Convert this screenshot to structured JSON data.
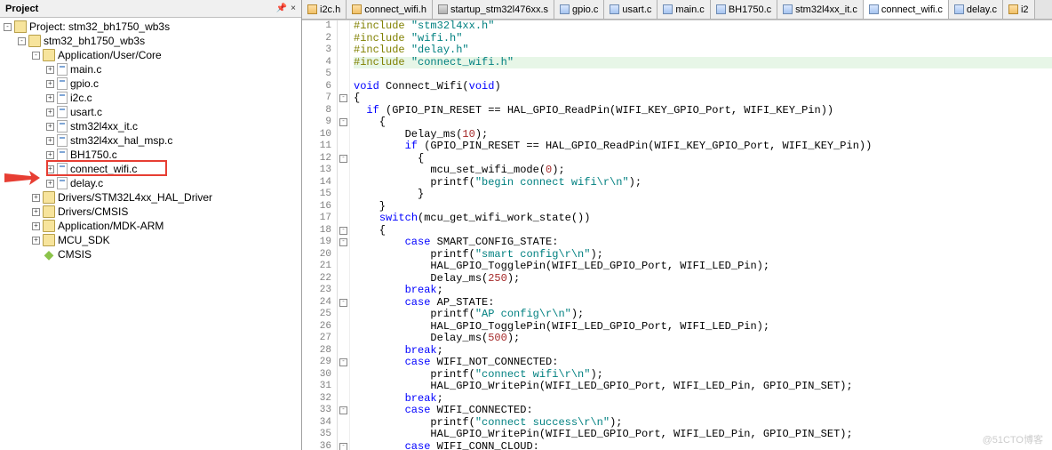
{
  "panel": {
    "title": "Project",
    "pin": "📌",
    "close": "×"
  },
  "tree": [
    {
      "d": 0,
      "exp": "-",
      "ico": "workspace",
      "label": "Project: stm32_bh1750_wb3s"
    },
    {
      "d": 1,
      "exp": "-",
      "ico": "folder-y",
      "label": "stm32_bh1750_wb3s"
    },
    {
      "d": 2,
      "exp": "-",
      "ico": "folder-y",
      "label": "Application/User/Core"
    },
    {
      "d": 3,
      "exp": "+",
      "ico": "cfile",
      "label": "main.c"
    },
    {
      "d": 3,
      "exp": "+",
      "ico": "cfile",
      "label": "gpio.c"
    },
    {
      "d": 3,
      "exp": "+",
      "ico": "cfile",
      "label": "i2c.c"
    },
    {
      "d": 3,
      "exp": "+",
      "ico": "cfile",
      "label": "usart.c"
    },
    {
      "d": 3,
      "exp": "+",
      "ico": "cfile",
      "label": "stm32l4xx_it.c"
    },
    {
      "d": 3,
      "exp": "+",
      "ico": "cfile",
      "label": "stm32l4xx_hal_msp.c"
    },
    {
      "d": 3,
      "exp": "+",
      "ico": "cfile",
      "label": "BH1750.c"
    },
    {
      "d": 3,
      "exp": "+",
      "ico": "cfile",
      "label": "connect_wifi.c",
      "hl": true
    },
    {
      "d": 3,
      "exp": "+",
      "ico": "cfile",
      "label": "delay.c"
    },
    {
      "d": 2,
      "exp": "+",
      "ico": "folder-y",
      "label": "Drivers/STM32L4xx_HAL_Driver"
    },
    {
      "d": 2,
      "exp": "+",
      "ico": "folder-y",
      "label": "Drivers/CMSIS"
    },
    {
      "d": 2,
      "exp": "+",
      "ico": "folder-y",
      "label": "Application/MDK-ARM"
    },
    {
      "d": 2,
      "exp": "+",
      "ico": "folder-y",
      "label": "MCU_SDK"
    },
    {
      "d": 2,
      "exp": " ",
      "ico": "cmsis",
      "label": "CMSIS",
      "cmsis": true
    }
  ],
  "tabs": [
    {
      "label": "i2c.h",
      "ico": "hfile"
    },
    {
      "label": "connect_wifi.h",
      "ico": "hfile"
    },
    {
      "label": "startup_stm32l476xx.s",
      "ico": "sfile"
    },
    {
      "label": "gpio.c",
      "ico": "cfile"
    },
    {
      "label": "usart.c",
      "ico": "cfile"
    },
    {
      "label": "main.c",
      "ico": "cfile"
    },
    {
      "label": "BH1750.c",
      "ico": "cfile"
    },
    {
      "label": "stm32l4xx_it.c",
      "ico": "cfile"
    },
    {
      "label": "connect_wifi.c",
      "ico": "cfile",
      "active": true
    },
    {
      "label": "delay.c",
      "ico": "cfile"
    },
    {
      "label": "i2",
      "ico": "hfile"
    }
  ],
  "code": [
    {
      "n": 1,
      "f": "",
      "t": [
        [
          "k-pre",
          "#include "
        ],
        [
          "k-str",
          "\"stm32l4xx.h\""
        ]
      ]
    },
    {
      "n": 2,
      "f": "",
      "t": [
        [
          "k-pre",
          "#include "
        ],
        [
          "k-str",
          "\"wifi.h\""
        ]
      ]
    },
    {
      "n": 3,
      "f": "",
      "t": [
        [
          "k-pre",
          "#include "
        ],
        [
          "k-str",
          "\"delay.h\""
        ]
      ]
    },
    {
      "n": 4,
      "f": "",
      "hl": true,
      "t": [
        [
          "k-pre",
          "#include "
        ],
        [
          "k-str",
          "\"connect_wifi.h\""
        ]
      ]
    },
    {
      "n": 5,
      "f": "",
      "t": []
    },
    {
      "n": 6,
      "f": "",
      "t": [
        [
          "k-type",
          "void"
        ],
        [
          "k-norm",
          " Connect_Wifi("
        ],
        [
          "k-type",
          "void"
        ],
        [
          "k-norm",
          ")"
        ]
      ]
    },
    {
      "n": 7,
      "f": "-",
      "t": [
        [
          "k-norm",
          "{"
        ]
      ]
    },
    {
      "n": 8,
      "f": "",
      "t": [
        [
          "k-norm",
          "  "
        ],
        [
          "k-kw",
          "if"
        ],
        [
          "k-norm",
          " (GPIO_PIN_RESET == HAL_GPIO_ReadPin(WIFI_KEY_GPIO_Port, WIFI_KEY_Pin))"
        ]
      ]
    },
    {
      "n": 9,
      "f": "-",
      "t": [
        [
          "k-norm",
          "    {"
        ]
      ]
    },
    {
      "n": 10,
      "f": "",
      "t": [
        [
          "k-norm",
          "        Delay_ms("
        ],
        [
          "k-num",
          "10"
        ],
        [
          "k-norm",
          ");"
        ]
      ]
    },
    {
      "n": 11,
      "f": "",
      "t": [
        [
          "k-norm",
          "        "
        ],
        [
          "k-kw",
          "if"
        ],
        [
          "k-norm",
          " (GPIO_PIN_RESET == HAL_GPIO_ReadPin(WIFI_KEY_GPIO_Port, WIFI_KEY_Pin))"
        ]
      ]
    },
    {
      "n": 12,
      "f": "-",
      "t": [
        [
          "k-norm",
          "          {"
        ]
      ]
    },
    {
      "n": 13,
      "f": "",
      "t": [
        [
          "k-norm",
          "            mcu_set_wifi_mode("
        ],
        [
          "k-num",
          "0"
        ],
        [
          "k-norm",
          ");"
        ]
      ]
    },
    {
      "n": 14,
      "f": "",
      "t": [
        [
          "k-norm",
          "            printf("
        ],
        [
          "k-str",
          "\"begin connect wifi\\r\\n\""
        ],
        [
          "k-norm",
          ");"
        ]
      ]
    },
    {
      "n": 15,
      "f": "",
      "t": [
        [
          "k-norm",
          "          }"
        ]
      ]
    },
    {
      "n": 16,
      "f": "",
      "t": [
        [
          "k-norm",
          "    }"
        ]
      ]
    },
    {
      "n": 17,
      "f": "",
      "t": [
        [
          "k-norm",
          "    "
        ],
        [
          "k-kw",
          "switch"
        ],
        [
          "k-norm",
          "(mcu_get_wifi_work_state())"
        ]
      ]
    },
    {
      "n": 18,
      "f": "-",
      "t": [
        [
          "k-norm",
          "    {"
        ]
      ]
    },
    {
      "n": 19,
      "f": "-",
      "t": [
        [
          "k-norm",
          "        "
        ],
        [
          "k-kw",
          "case"
        ],
        [
          "k-norm",
          " SMART_CONFIG_STATE:"
        ]
      ]
    },
    {
      "n": 20,
      "f": "",
      "t": [
        [
          "k-norm",
          "            printf("
        ],
        [
          "k-str",
          "\"smart config\\r\\n\""
        ],
        [
          "k-norm",
          ");"
        ]
      ]
    },
    {
      "n": 21,
      "f": "",
      "t": [
        [
          "k-norm",
          "            HAL_GPIO_TogglePin(WIFI_LED_GPIO_Port, WIFI_LED_Pin);"
        ]
      ]
    },
    {
      "n": 22,
      "f": "",
      "t": [
        [
          "k-norm",
          "            Delay_ms("
        ],
        [
          "k-num",
          "250"
        ],
        [
          "k-norm",
          ");"
        ]
      ]
    },
    {
      "n": 23,
      "f": "",
      "t": [
        [
          "k-norm",
          "        "
        ],
        [
          "k-kw",
          "break"
        ],
        [
          "k-norm",
          ";"
        ]
      ]
    },
    {
      "n": 24,
      "f": "-",
      "t": [
        [
          "k-norm",
          "        "
        ],
        [
          "k-kw",
          "case"
        ],
        [
          "k-norm",
          " AP_STATE:"
        ]
      ]
    },
    {
      "n": 25,
      "f": "",
      "t": [
        [
          "k-norm",
          "            printf("
        ],
        [
          "k-str",
          "\"AP config\\r\\n\""
        ],
        [
          "k-norm",
          ");"
        ]
      ]
    },
    {
      "n": 26,
      "f": "",
      "t": [
        [
          "k-norm",
          "            HAL_GPIO_TogglePin(WIFI_LED_GPIO_Port, WIFI_LED_Pin);"
        ]
      ]
    },
    {
      "n": 27,
      "f": "",
      "t": [
        [
          "k-norm",
          "            Delay_ms("
        ],
        [
          "k-num",
          "500"
        ],
        [
          "k-norm",
          ");"
        ]
      ]
    },
    {
      "n": 28,
      "f": "",
      "t": [
        [
          "k-norm",
          "        "
        ],
        [
          "k-kw",
          "break"
        ],
        [
          "k-norm",
          ";"
        ]
      ]
    },
    {
      "n": 29,
      "f": "-",
      "t": [
        [
          "k-norm",
          "        "
        ],
        [
          "k-kw",
          "case"
        ],
        [
          "k-norm",
          " WIFI_NOT_CONNECTED:"
        ]
      ]
    },
    {
      "n": 30,
      "f": "",
      "t": [
        [
          "k-norm",
          "            printf("
        ],
        [
          "k-str",
          "\"connect wifi\\r\\n\""
        ],
        [
          "k-norm",
          ");"
        ]
      ]
    },
    {
      "n": 31,
      "f": "",
      "t": [
        [
          "k-norm",
          "            HAL_GPIO_WritePin(WIFI_LED_GPIO_Port, WIFI_LED_Pin, GPIO_PIN_SET);"
        ]
      ]
    },
    {
      "n": 32,
      "f": "",
      "t": [
        [
          "k-norm",
          "        "
        ],
        [
          "k-kw",
          "break"
        ],
        [
          "k-norm",
          ";"
        ]
      ]
    },
    {
      "n": 33,
      "f": "-",
      "t": [
        [
          "k-norm",
          "        "
        ],
        [
          "k-kw",
          "case"
        ],
        [
          "k-norm",
          " WIFI_CONNECTED:"
        ]
      ]
    },
    {
      "n": 34,
      "f": "",
      "t": [
        [
          "k-norm",
          "            printf("
        ],
        [
          "k-str",
          "\"connect success\\r\\n\""
        ],
        [
          "k-norm",
          ");"
        ]
      ]
    },
    {
      "n": 35,
      "f": "",
      "t": [
        [
          "k-norm",
          "            HAL_GPIO_WritePin(WIFI_LED_GPIO_Port, WIFI_LED_Pin, GPIO_PIN_SET);"
        ]
      ]
    },
    {
      "n": 36,
      "f": "-",
      "t": [
        [
          "k-norm",
          "        "
        ],
        [
          "k-kw",
          "case"
        ],
        [
          "k-norm",
          " WIFI_CONN_CLOUD:"
        ]
      ]
    }
  ],
  "watermark": "@51CTO博客"
}
